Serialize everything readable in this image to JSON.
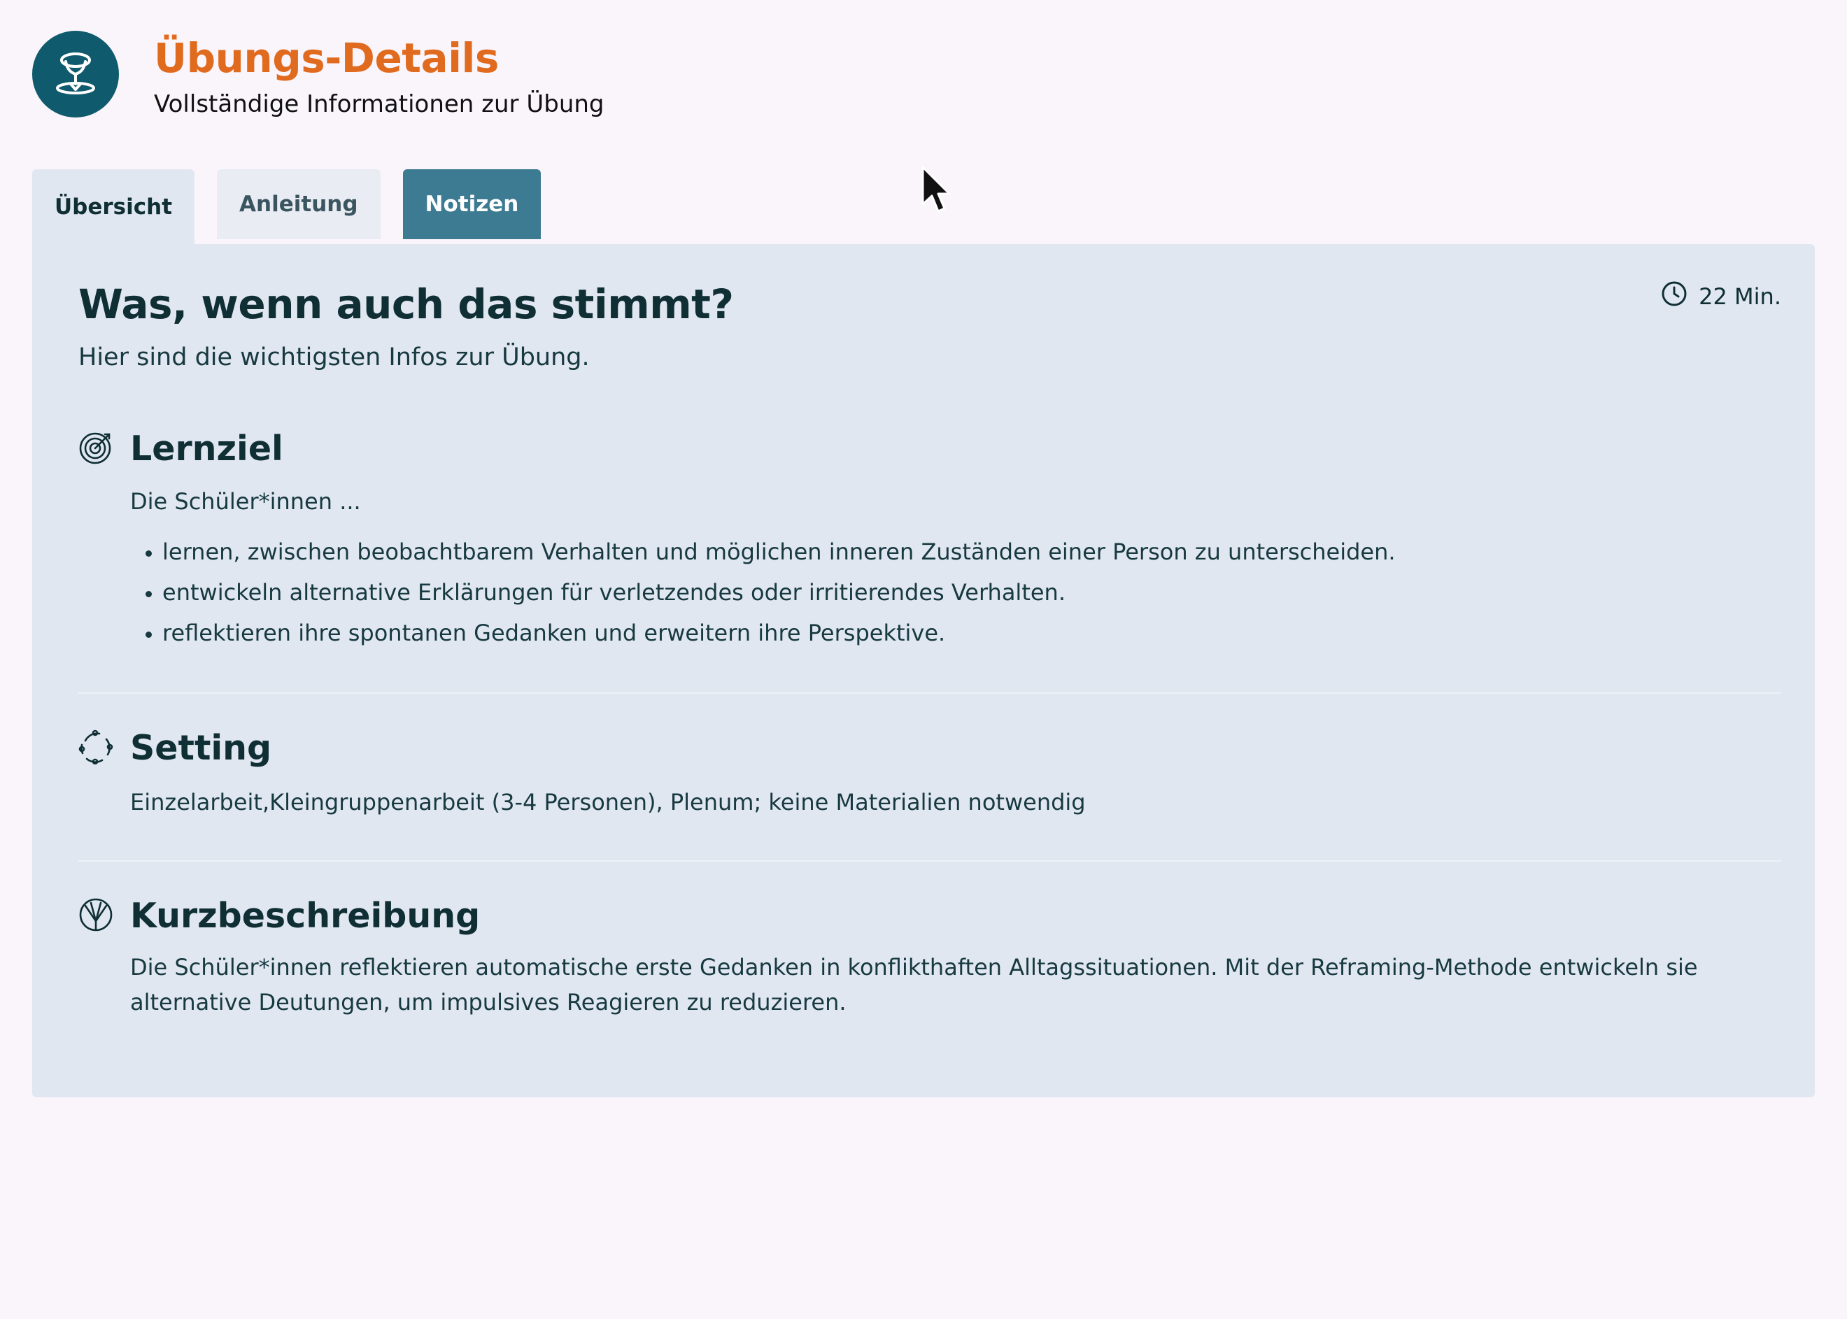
{
  "header": {
    "logo_icon": "trophy-outline-icon",
    "title": "Übungs-Details",
    "subtitle": "Vollständige Informationen zur Übung"
  },
  "tabs": [
    {
      "label": "Übersicht",
      "state": "active"
    },
    {
      "label": "Anleitung",
      "state": "inactive"
    },
    {
      "label": "Notizen",
      "state": "highlighted"
    }
  ],
  "panel": {
    "title": "Was, wenn auch das stimmt?",
    "intro": "Hier sind die wichtigsten Infos zur Übung.",
    "duration": {
      "icon": "clock-icon",
      "label": "22 Min."
    }
  },
  "sections": {
    "lernziel": {
      "icon": "target-icon",
      "title": "Lernziel",
      "intro": "Die Schüler*innen ...",
      "items": [
        "lernen, zwischen beobachtbarem Verhalten und möglichen inneren Zuständen einer Person zu unterscheiden.",
        "entwickeln alternative Erklärungen für verletzendes oder irritierendes Verhalten.",
        "reflektieren ihre spontanen Gedanken und erweitern ihre Perspektive."
      ]
    },
    "setting": {
      "icon": "circular-arrows-icon",
      "title": "Setting",
      "text": "Einzelarbeit,Kleingruppenarbeit (3-4 Personen), Plenum; keine Materialien notwendig"
    },
    "kurzbeschreibung": {
      "icon": "fan-icon",
      "title": "Kurzbeschreibung",
      "text": "Die Schüler*innen reflektieren automatische erste Gedanken in konflikthaften Alltagssituationen. Mit der Reframing-Methode entwickeln sie alternative Deutungen, um impulsives Reagieren zu reduzieren."
    }
  },
  "colors": {
    "accent": "#e06b1f",
    "logo_bg": "#0f5a6c",
    "tab_highlight": "#3d7b92",
    "panel_bg": "#e1e7f1",
    "page_bg": "#faf5fb"
  }
}
